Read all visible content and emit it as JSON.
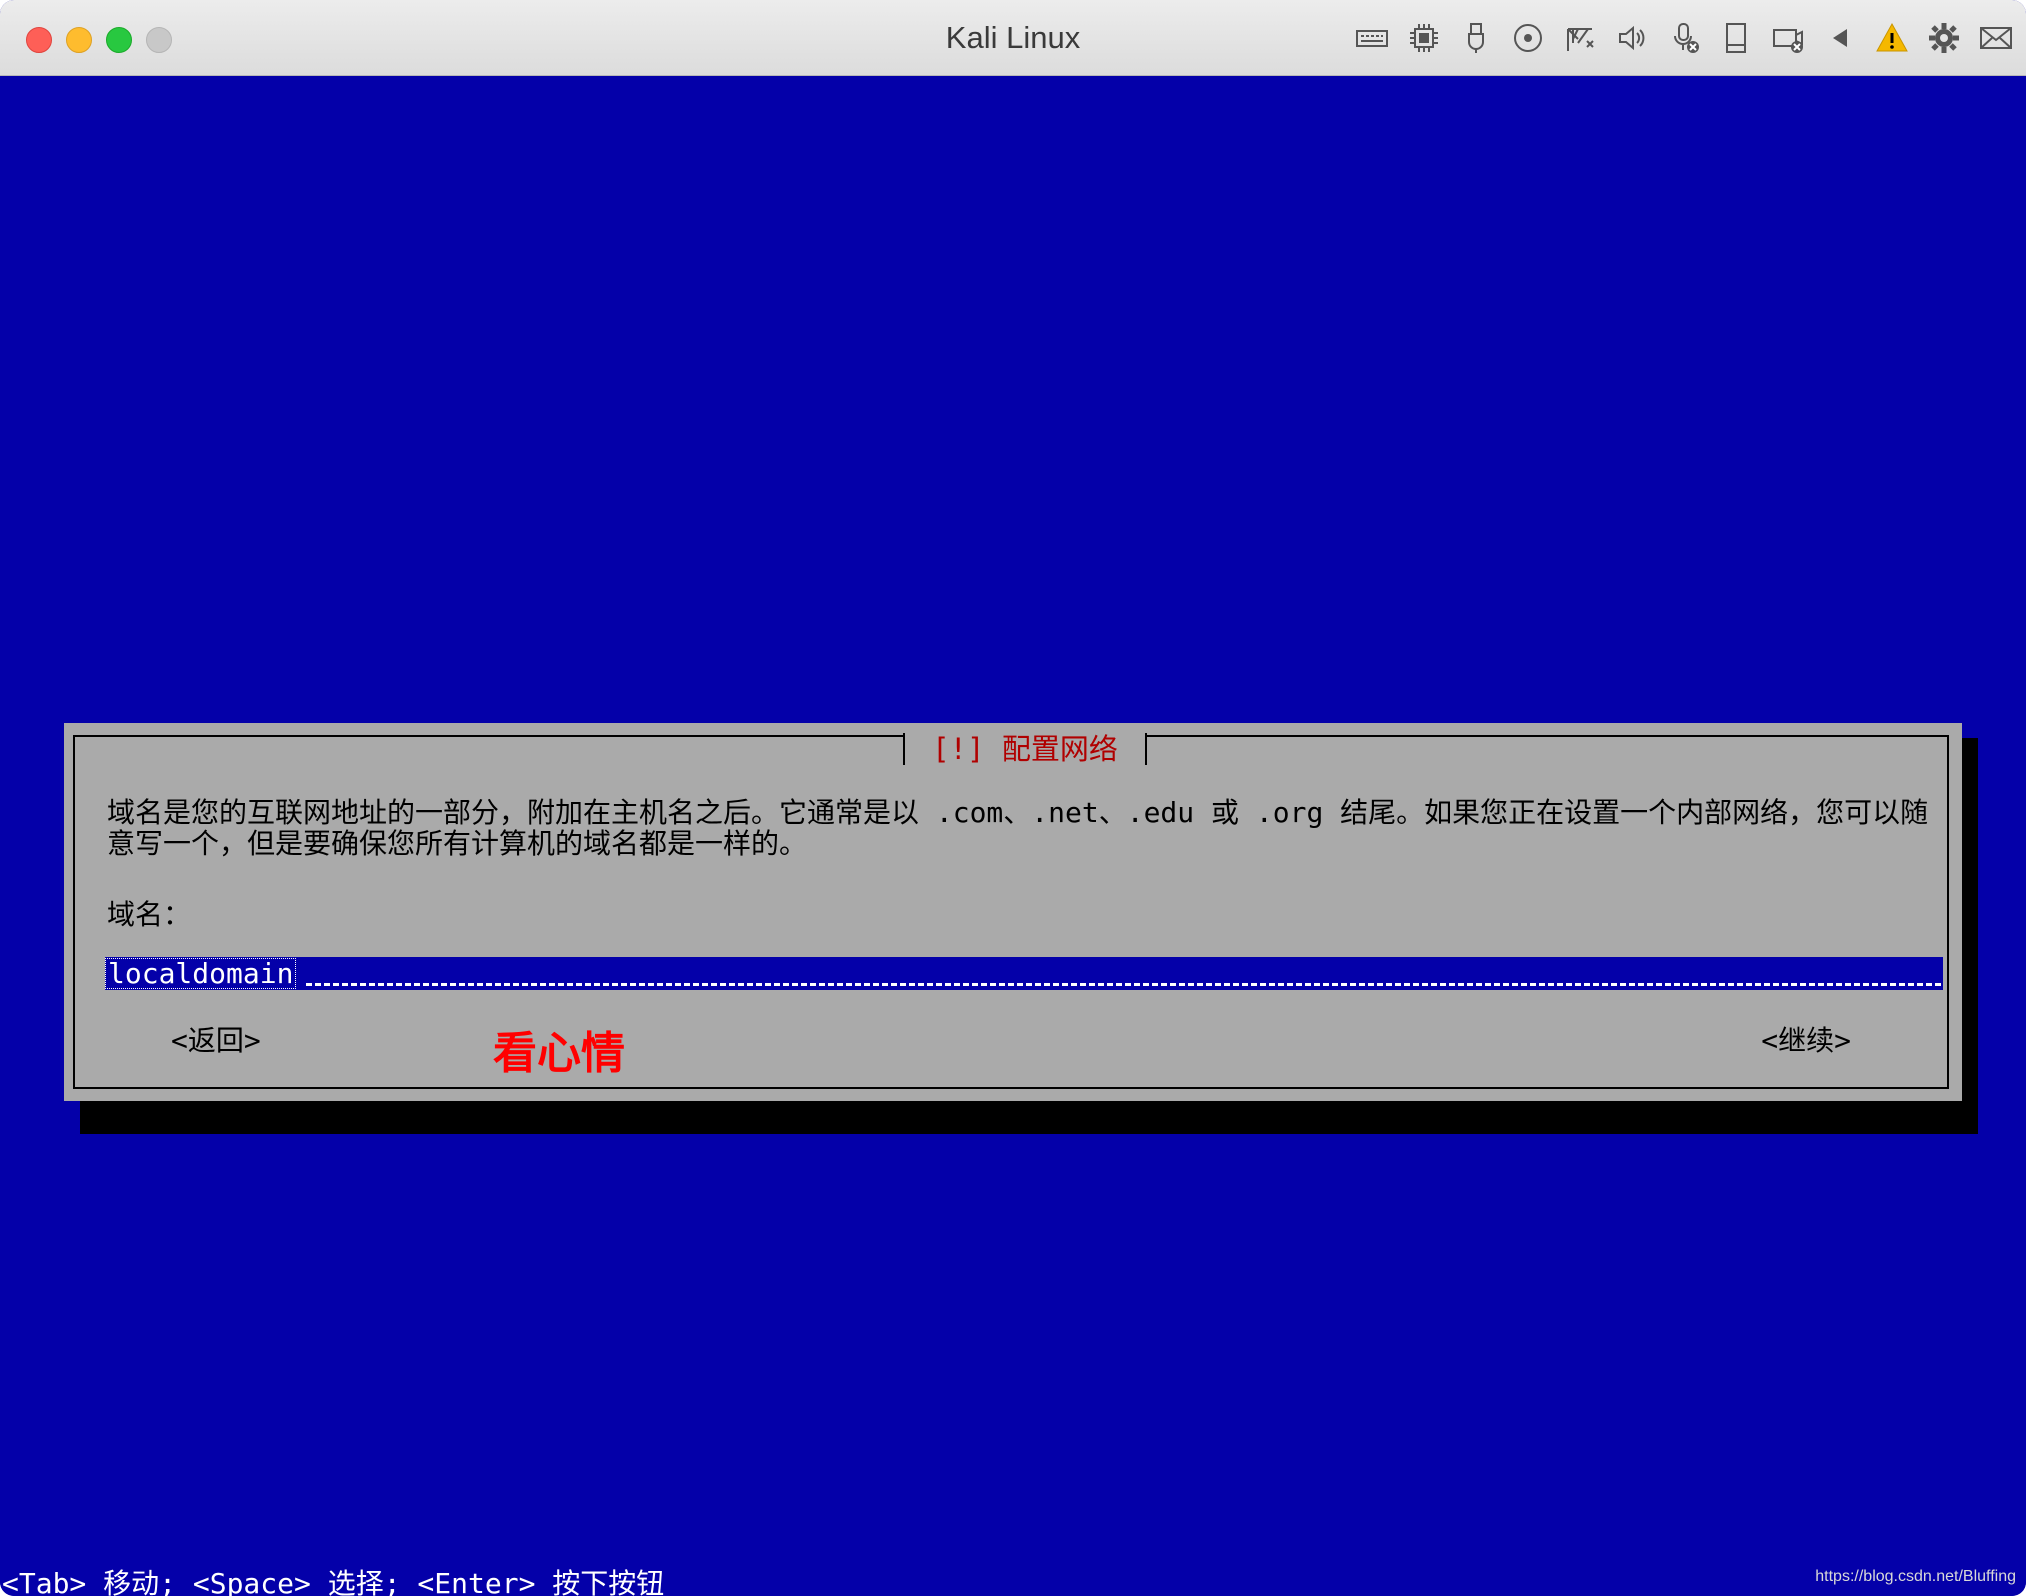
{
  "window": {
    "title": "Kali Linux",
    "toolbar_icons": [
      "keyboard-icon",
      "cpu-icon",
      "usb-icon",
      "disc-icon",
      "network-icon",
      "speaker-icon",
      "microphone-icon",
      "storage-icon",
      "camera-icon",
      "arrow-left-icon",
      "warning-icon",
      "gear-icon",
      "mail-icon"
    ]
  },
  "dialog": {
    "title": "[!] 配置网络",
    "description": "域名是您的互联网地址的一部分，附加在主机名之后。它通常是以 .com、.net、.edu 或 .org 结尾。如果您正在设置一个内部网络，您可以随意写一个，但是要确保您所有计算机的域名都是一样的。",
    "field_label": "域名：",
    "field_value": "localdomain",
    "back_button": "<返回>",
    "continue_button": "<继续>"
  },
  "overlay_note": "看心情",
  "hints": "<Tab> 移动; <Space> 选择; <Enter> 按下按钮",
  "watermark": "https://blog.csdn.net/Bluffing",
  "colors": {
    "screen_bg": "#0400a9",
    "dialog_bg": "#aaaaaa",
    "dialog_title": "#b00000",
    "overlay_note": "#ff0000"
  }
}
